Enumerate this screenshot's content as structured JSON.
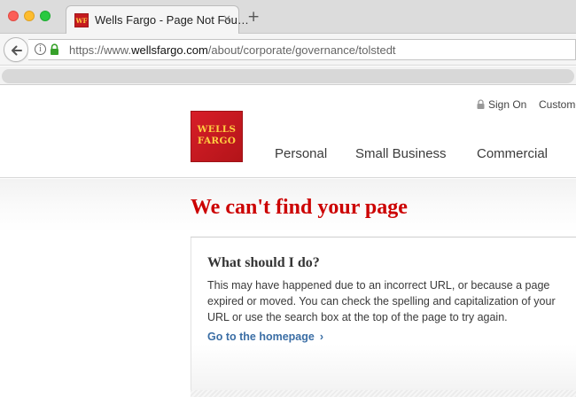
{
  "browser": {
    "tab_title": "Wells Fargo - Page Not Fou…",
    "tab_favicon_text": "WF",
    "tab_close_icon": "×",
    "new_tab_icon": "+",
    "url_prefix": "https://www.",
    "url_host": "wellsfargo.com",
    "url_path": "/about/corporate/governance/tolstedt"
  },
  "site": {
    "utility": {
      "sign_on": "Sign On",
      "customer": "Custome"
    },
    "logo_line1": "WELLS",
    "logo_line2": "FARGO",
    "nav": {
      "personal": "Personal",
      "small_business": "Small Business",
      "commercial": "Commercial"
    }
  },
  "main": {
    "title": "We can't find your page",
    "panel_heading": "What should I do?",
    "panel_body": "This may have happened due to an incorrect URL, or because a page expired or moved. You can check the spelling and capitalization of your URL or use the search box at the top of the page to try again.",
    "home_link": "Go to the homepage",
    "home_link_chevron": "›"
  },
  "colors": {
    "brand_red": "#d71e28",
    "brand_gold": "#ffcd41",
    "title_red": "#cc0000",
    "link_blue": "#3b6ea5"
  }
}
